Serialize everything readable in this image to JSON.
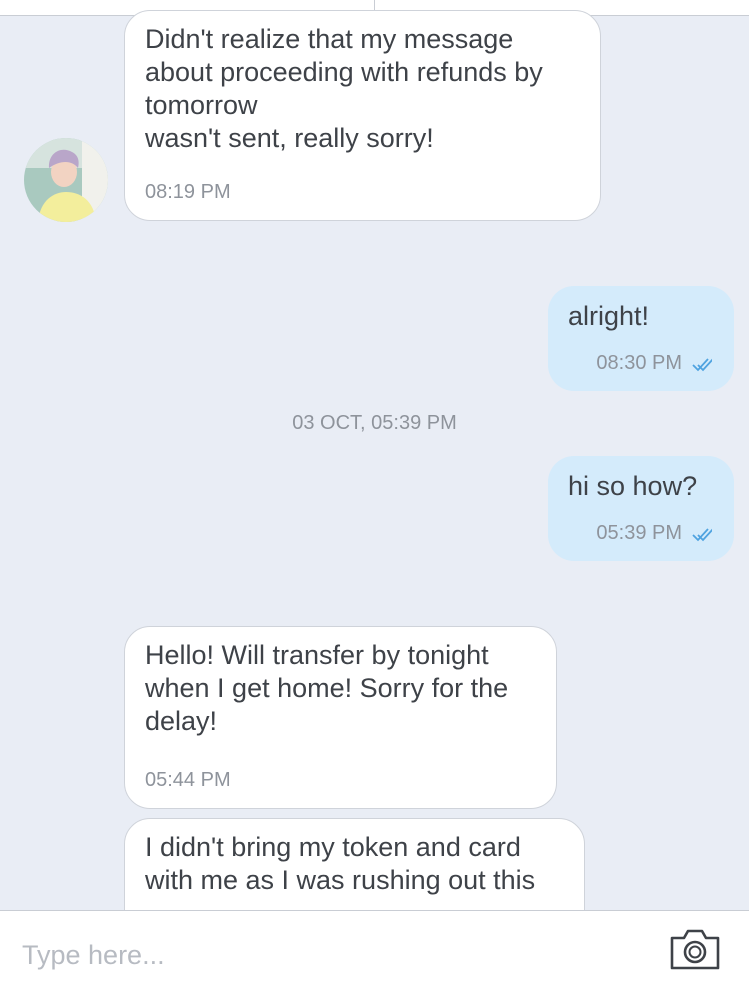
{
  "messages": [
    {
      "direction": "in",
      "text": "Didn't realize that my message about proceeding with refunds by tomorrow\nwasn't sent, really sorry!",
      "time": "08:19 PM"
    },
    {
      "direction": "out",
      "text": "alright!",
      "time": "08:30 PM"
    },
    {
      "direction": "out",
      "text": "hi so how?",
      "time": "05:39 PM"
    },
    {
      "direction": "in",
      "text": "Hello! Will transfer by tonight when I get home! Sorry for the delay!",
      "time": "05:44 PM"
    },
    {
      "direction": "in",
      "text": "I didn't bring my token and card with me as I was rushing out this",
      "time": ""
    }
  ],
  "date_separator": "03 OCT, 05:39 PM",
  "composer": {
    "placeholder": "Type here..."
  },
  "icons": {
    "read_receipt": "double-check-icon",
    "camera": "camera-icon"
  },
  "colors": {
    "incoming_bubble": "#ffffff",
    "outgoing_bubble": "#d4ebfb",
    "background": "#e9edf5",
    "read_tick": "#4fa3e0"
  }
}
